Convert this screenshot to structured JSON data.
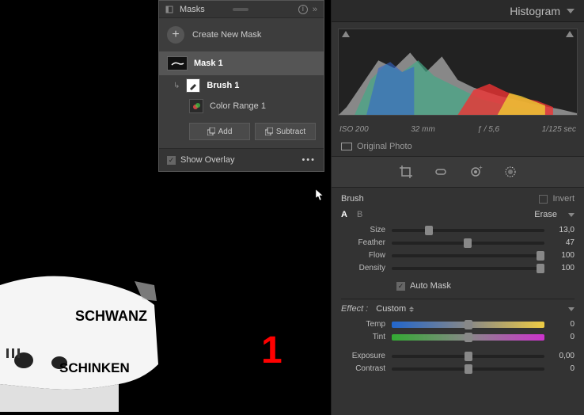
{
  "annotation": "1",
  "rightPanel": {
    "title": "Histogram",
    "meta": {
      "iso": "ISO 200",
      "focal": "32 mm",
      "aperture": "ƒ / 5,6",
      "shutter": "1/125 sec"
    },
    "originalPhoto": "Original Photo",
    "brush": {
      "title": "Brush",
      "invert": "Invert",
      "a": "A",
      "b": "B",
      "erase": "Erase",
      "size": {
        "label": "Size",
        "value": "13,0",
        "pos": 22
      },
      "feather": {
        "label": "Feather",
        "value": "47",
        "pos": 47
      },
      "flow": {
        "label": "Flow",
        "value": "100",
        "pos": 100
      },
      "density": {
        "label": "Density",
        "value": "100",
        "pos": 100
      },
      "autoMask": "Auto Mask"
    },
    "effect": {
      "label": "Effect :",
      "selection": "Custom",
      "temp": {
        "label": "Temp",
        "value": "0",
        "pos": 50
      },
      "tint": {
        "label": "Tint",
        "value": "0",
        "pos": 50
      },
      "exposure": {
        "label": "Exposure",
        "value": "0,00",
        "pos": 50
      },
      "contrast": {
        "label": "Contrast",
        "value": "0",
        "pos": 50
      }
    }
  },
  "masksPanel": {
    "title": "Masks",
    "createNew": "Create New Mask",
    "mask1": "Mask 1",
    "brush1": "Brush 1",
    "colorRange": "Color Range 1",
    "add": "Add",
    "subtract": "Subtract",
    "showOverlay": "Show Overlay"
  },
  "carText1": "SCHWANZ",
  "carText2": "SCHINKEN"
}
